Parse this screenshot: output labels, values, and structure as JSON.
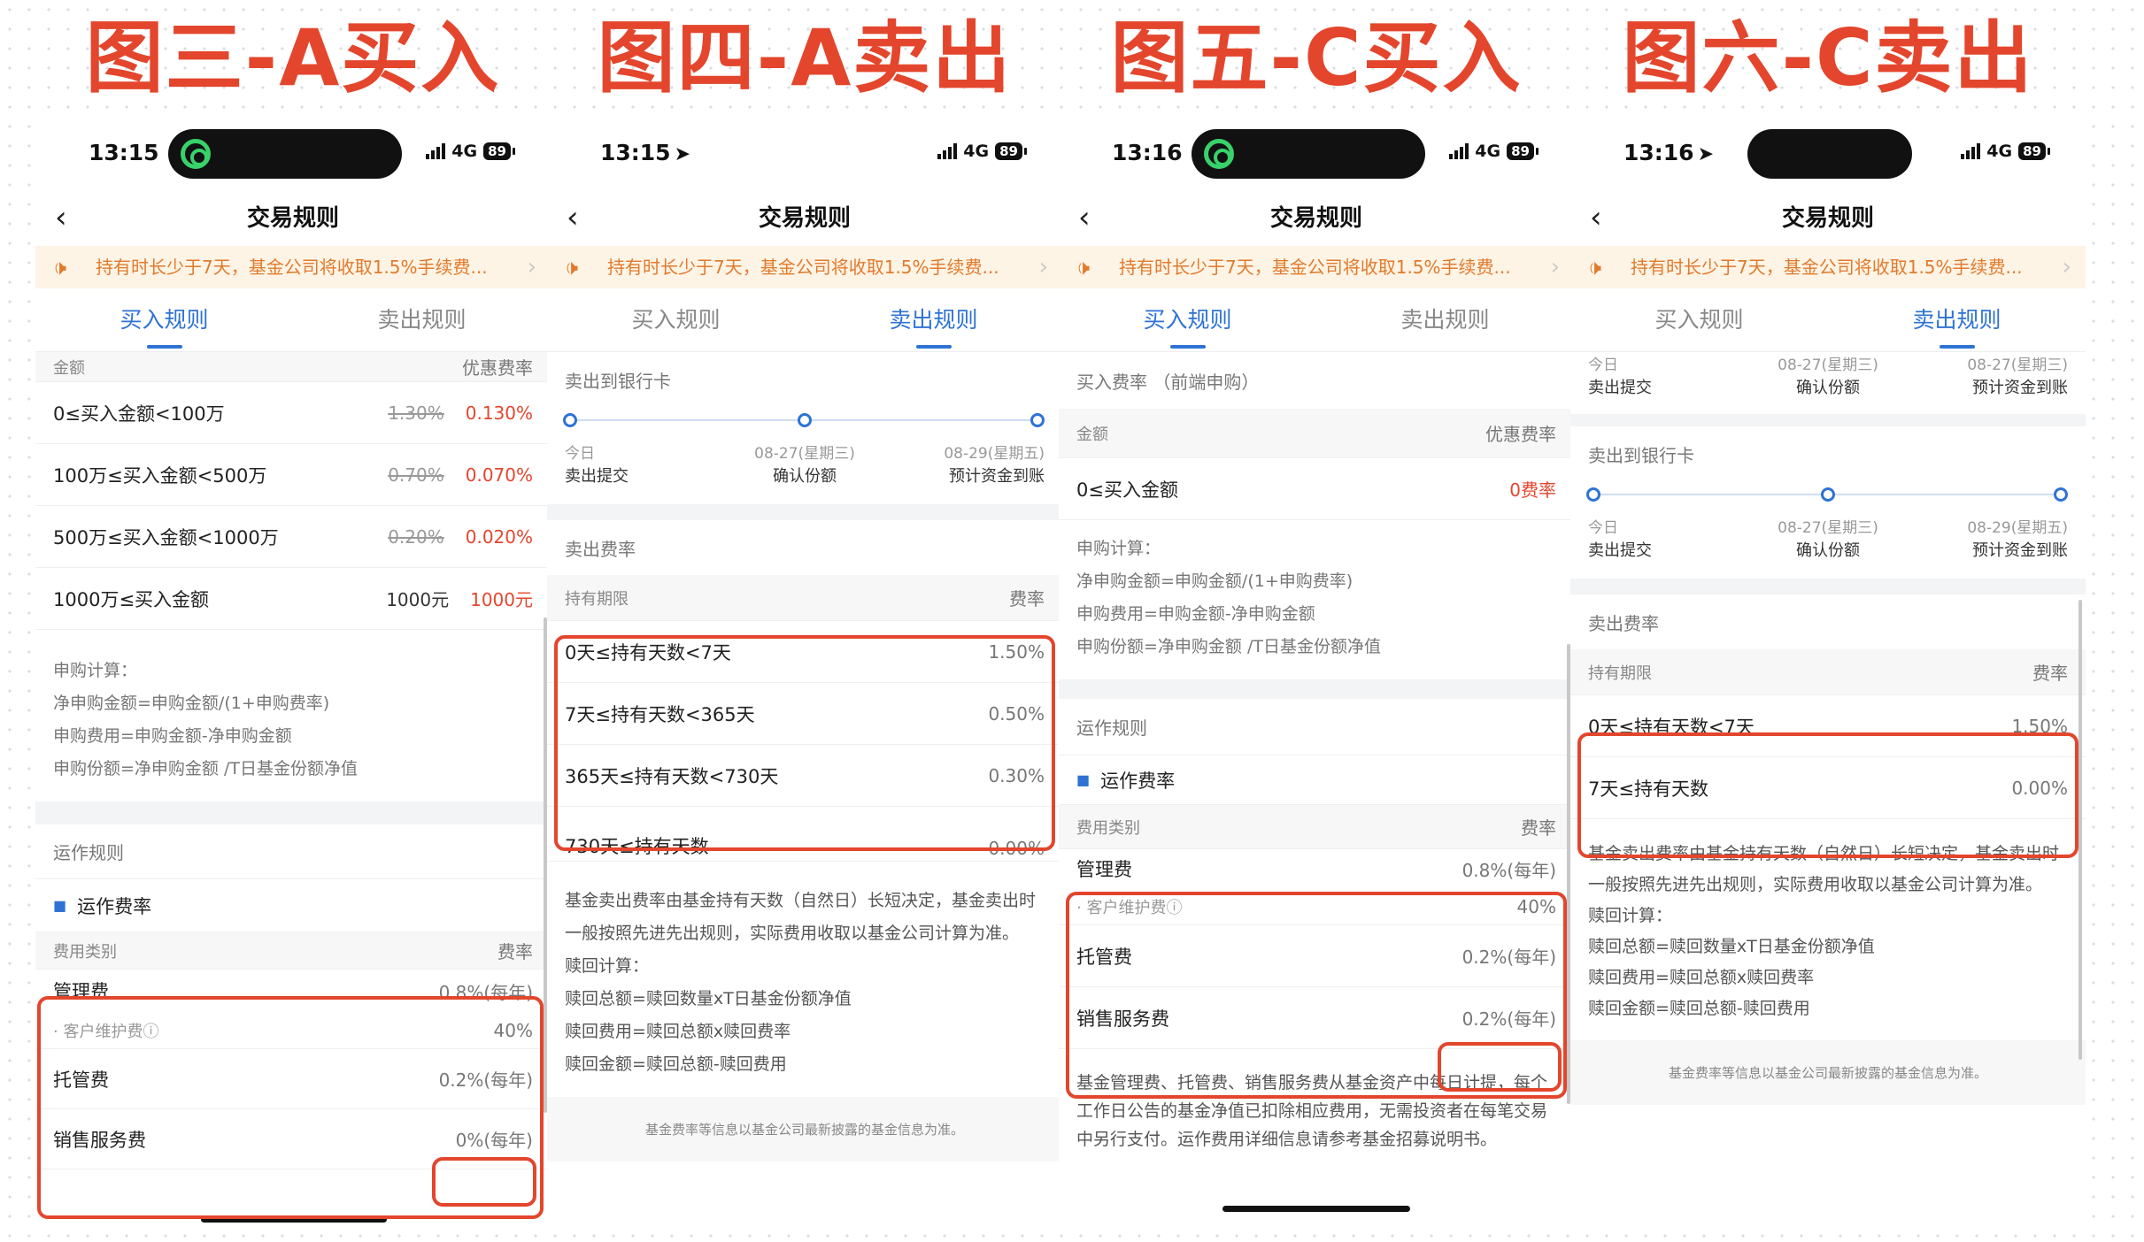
{
  "titles": [
    "图三-A买入",
    "图四-A卖出",
    "图五-C买入",
    "图六-C卖出"
  ],
  "common": {
    "nav_title": "交易规则",
    "back_glyph": "‹",
    "notice": "持有时长少于7天，基金公司将收取1.5%手续费...",
    "more_glyph": "›",
    "tab_buy": "买入规则",
    "tab_sell": "卖出规则",
    "network": "4G",
    "battery": "89",
    "footer": "基金费率等信息以基金公司最新披露的基金信息为准。",
    "accent_color": "#2e73d4",
    "highlight_color": "#e3462d",
    "notice_color": "#e27a2b"
  },
  "p1": {
    "time": "13:15",
    "fee_header": {
      "left": "金额",
      "right": "优惠费率"
    },
    "fee_rows": [
      {
        "range": "0≤买入金额<100万",
        "orig": "1.30%",
        "disc": "0.130%"
      },
      {
        "range": "100万≤买入金额<500万",
        "orig": "0.70%",
        "disc": "0.070%"
      },
      {
        "range": "500万≤买入金额<1000万",
        "orig": "0.20%",
        "disc": "0.020%"
      },
      {
        "range": "1000万≤买入金额",
        "orig": "1000元",
        "disc": "1000元"
      }
    ],
    "calc": [
      "申购计算：",
      "净申购金额=申购金额/(1+申购费率)",
      "申购费用=申购金额-净申购金额",
      "申购份额=净申购金额 /T日基金份额净值"
    ],
    "ops_title": "运作规则",
    "ops_sub": "运作费率",
    "ops_header": {
      "left": "费用类别",
      "right": "费率"
    },
    "mgmt": {
      "label": "管理费",
      "value": "0.8%(每年)",
      "sub_label": "· 客户维护费ⓘ",
      "sub_value": "40%"
    },
    "custody": {
      "label": "托管费",
      "value": "0.2%(每年)"
    },
    "sales": {
      "label": "销售服务费",
      "value": "0%(每年)"
    }
  },
  "p2": {
    "time": "13:15",
    "to_bank": "卖出到银行卡",
    "timeline": [
      {
        "date": "今日",
        "step": "卖出提交"
      },
      {
        "date": "08-27(星期三)",
        "step": "确认份额"
      },
      {
        "date": "08-29(星期五)",
        "step": "预计资金到账"
      }
    ],
    "fee_title": "卖出费率",
    "fee_header": {
      "left": "持有期限",
      "right": "费率"
    },
    "fee_rows": [
      {
        "range": "0天≤持有天数<7天",
        "rate": "1.50%"
      },
      {
        "range": "7天≤持有天数<365天",
        "rate": "0.50%"
      },
      {
        "range": "365天≤持有天数<730天",
        "rate": "0.30%"
      },
      {
        "range": "730天≤持有天数",
        "rate": "0.00%"
      }
    ],
    "desc": [
      "基金卖出费率由基金持有天数（自然日）长短决定，基金卖出时一般按照先进先出规则，实际费用收取以基金公司计算为准。",
      "赎回计算：",
      "赎回总额=赎回数量xT日基金份额净值",
      "赎回费用=赎回总额x赎回费率",
      "赎回金额=赎回总额-赎回费用"
    ]
  },
  "p3": {
    "time": "13:16",
    "fee_title": "买入费率 （前端申购）",
    "fee_header": {
      "left": "金额",
      "right": "优惠费率"
    },
    "fee_row": {
      "range": "0≤买入金额",
      "rate": "0费率"
    },
    "calc": [
      "申购计算：",
      "净申购金额=申购金额/(1+申购费率)",
      "申购费用=申购金额-净申购金额",
      "申购份额=净申购金额 /T日基金份额净值"
    ],
    "ops_title": "运作规则",
    "ops_sub": "运作费率",
    "ops_header": {
      "left": "费用类别",
      "right": "费率"
    },
    "mgmt": {
      "label": "管理费",
      "value": "0.8%(每年)",
      "sub_label": "· 客户维护费ⓘ",
      "sub_value": "40%"
    },
    "custody": {
      "label": "托管费",
      "value": "0.2%(每年)"
    },
    "sales": {
      "label": "销售服务费",
      "value": "0.2%(每年)"
    },
    "desc": "基金管理费、托管费、销售服务费从基金资产中每日计提，每个工作日公告的基金净值已扣除相应费用，无需投资者在每笔交易中另行支付。运作费用详细信息请参考基金招募说明书。"
  },
  "p4": {
    "time": "13:16",
    "top_timeline": [
      {
        "date": "今日",
        "step": "卖出提交"
      },
      {
        "date": "08-27(星期三)",
        "step": "确认份额"
      },
      {
        "date": "08-27(星期三)",
        "step": "预计资金到账"
      }
    ],
    "to_bank": "卖出到银行卡",
    "timeline": [
      {
        "date": "今日",
        "step": "卖出提交"
      },
      {
        "date": "08-27(星期三)",
        "step": "确认份额"
      },
      {
        "date": "08-29(星期五)",
        "step": "预计资金到账"
      }
    ],
    "fee_title": "卖出费率",
    "fee_header": {
      "left": "持有期限",
      "right": "费率"
    },
    "fee_rows": [
      {
        "range": "0天≤持有天数<7天",
        "rate": "1.50%"
      },
      {
        "range": "7天≤持有天数",
        "rate": "0.00%"
      }
    ],
    "desc": [
      "基金卖出费率由基金持有天数（自然日）长短决定，基金卖出时一般按照先进先出规则，实际费用收取以基金公司计算为准。",
      "赎回计算：",
      "赎回总额=赎回数量xT日基金份额净值",
      "赎回费用=赎回总额x赎回费率",
      "赎回金额=赎回总额-赎回费用"
    ]
  }
}
